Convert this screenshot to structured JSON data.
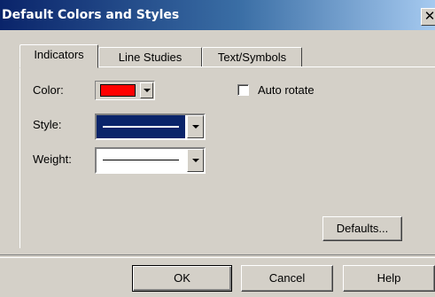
{
  "window": {
    "title": "Default Colors and Styles",
    "close_glyph": "✕"
  },
  "tabs": [
    {
      "label": "Indicators",
      "active": true
    },
    {
      "label": "Line Studies",
      "active": false
    },
    {
      "label": "Text/Symbols",
      "active": false
    }
  ],
  "fields": {
    "color_label": "Color:",
    "color_value": "#ff0000",
    "style_label": "Style:",
    "weight_label": "Weight:",
    "auto_rotate_label": "Auto rotate",
    "auto_rotate_checked": false
  },
  "buttons": {
    "defaults": "Defaults...",
    "ok": "OK",
    "cancel": "Cancel",
    "help": "Help"
  },
  "colors": {
    "title_gradient_start": "#0a246a",
    "window_face": "#d4d0c8",
    "selection": "#0a246a",
    "swatch_red": "#ff0000"
  }
}
